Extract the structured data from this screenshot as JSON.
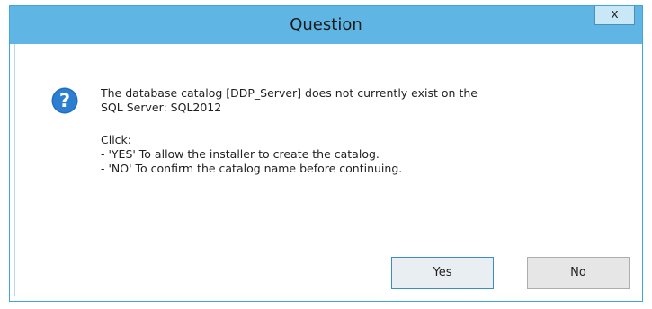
{
  "dialog": {
    "title": "Question",
    "close_glyph": "x",
    "icon": "question-icon",
    "message_line1": "The database catalog [DDP_Server] does not currently exist on the",
    "message_line2": "SQL Server: SQL2012",
    "click_label": "Click:",
    "option_yes": "- 'YES' To allow the installer to create the catalog.",
    "option_no": "- 'NO' To confirm the catalog name before continuing.",
    "yes_label": "Yes",
    "no_label": "No"
  },
  "colors": {
    "titlebar": "#5fb6e4",
    "border": "#3fa6dc",
    "icon_blue": "#1e6fc2"
  }
}
